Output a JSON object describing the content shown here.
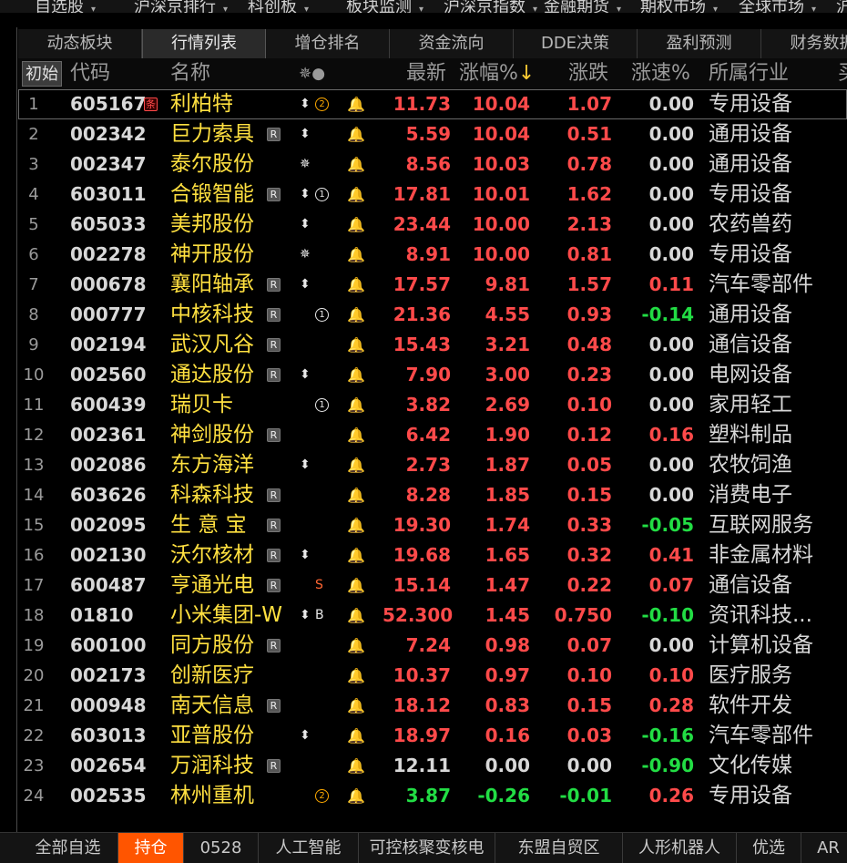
{
  "top_menu": [
    {
      "label": "自选股",
      "caret": "▾"
    },
    {
      "label": "沪深京排行",
      "caret": "▾"
    },
    {
      "label": "科创板",
      "caret": "▾"
    },
    {
      "label": "板块监测",
      "caret": "▾"
    },
    {
      "label": "沪深京指数",
      "caret": "▾"
    },
    {
      "label": "金融期货",
      "caret": "▾"
    },
    {
      "label": "期权市场",
      "caret": "▾"
    },
    {
      "label": "全球市场",
      "caret": "▾"
    },
    {
      "label": "沪",
      "caret": ""
    }
  ],
  "tabs": [
    "动态板块",
    "行情列表",
    "增仓排名",
    "资金流向",
    "DDE决策",
    "盈利预测",
    "财务数据"
  ],
  "header": {
    "index": "初始",
    "code": "代码",
    "name": "名称",
    "marks": "✵●",
    "last": "最新",
    "pct": "涨幅%",
    "pct_arrow": "↓",
    "chg": "涨跌",
    "speed": "涨速%",
    "industry": "所属行业",
    "extra": "买"
  },
  "rows": [
    {
      "idx": "1",
      "code": "605167",
      "name": "利柏特",
      "tag": "条",
      "tagType": "t",
      "m1": "⬍",
      "m2": "②",
      "m2c": "orange",
      "bell": "on",
      "last": "11.73",
      "pct": "10.04",
      "chg": "1.07",
      "speed": "0.00",
      "industry": "专用设备",
      "dir": "up",
      "spdDir": "flat"
    },
    {
      "idx": "2",
      "code": "002342",
      "name": "巨力索具",
      "tag": "R",
      "tagType": "r",
      "m1": "⬍",
      "m2": "",
      "m2c": "",
      "bell": "on",
      "last": "5.59",
      "pct": "10.04",
      "chg": "0.51",
      "speed": "0.00",
      "industry": "通用设备",
      "dir": "up",
      "spdDir": "flat"
    },
    {
      "idx": "3",
      "code": "002347",
      "name": "泰尔股份",
      "tag": "",
      "tagType": "",
      "m1": "✵",
      "m2": "",
      "m2c": "",
      "bell": "on",
      "last": "8.56",
      "pct": "10.03",
      "chg": "0.78",
      "speed": "0.00",
      "industry": "通用设备",
      "dir": "up",
      "spdDir": "flat"
    },
    {
      "idx": "4",
      "code": "603011",
      "name": "合锻智能",
      "tag": "R",
      "tagType": "r",
      "m1": "⬍",
      "m2": "①",
      "m2c": "",
      "bell": "on",
      "last": "17.81",
      "pct": "10.01",
      "chg": "1.62",
      "speed": "0.00",
      "industry": "专用设备",
      "dir": "up",
      "spdDir": "flat"
    },
    {
      "idx": "5",
      "code": "605033",
      "name": "美邦股份",
      "tag": "",
      "tagType": "",
      "m1": "⬍",
      "m2": "",
      "m2c": "",
      "bell": "off",
      "last": "23.44",
      "pct": "10.00",
      "chg": "2.13",
      "speed": "0.00",
      "industry": "农药兽药",
      "dir": "up",
      "spdDir": "flat"
    },
    {
      "idx": "6",
      "code": "002278",
      "name": "神开股份",
      "tag": "",
      "tagType": "",
      "m1": "✵",
      "m2": "",
      "m2c": "",
      "bell": "off",
      "last": "8.91",
      "pct": "10.00",
      "chg": "0.81",
      "speed": "0.00",
      "industry": "专用设备",
      "dir": "up",
      "spdDir": "flat"
    },
    {
      "idx": "7",
      "code": "000678",
      "name": "襄阳轴承",
      "tag": "R",
      "tagType": "r",
      "m1": "⬍",
      "m2": "",
      "m2c": "",
      "bell": "on",
      "last": "17.57",
      "pct": "9.81",
      "chg": "1.57",
      "speed": "0.11",
      "industry": "汽车零部件",
      "dir": "up",
      "spdDir": "up"
    },
    {
      "idx": "8",
      "code": "000777",
      "name": "中核科技",
      "tag": "R",
      "tagType": "r",
      "m1": "",
      "m2": "①",
      "m2c": "",
      "bell": "on",
      "last": "21.36",
      "pct": "4.55",
      "chg": "0.93",
      "speed": "-0.14",
      "industry": "通用设备",
      "dir": "up",
      "spdDir": "down"
    },
    {
      "idx": "9",
      "code": "002194",
      "name": "武汉凡谷",
      "tag": "R",
      "tagType": "r",
      "m1": "",
      "m2": "",
      "m2c": "",
      "bell": "on",
      "last": "15.43",
      "pct": "3.21",
      "chg": "0.48",
      "speed": "0.00",
      "industry": "通信设备",
      "dir": "up",
      "spdDir": "flat"
    },
    {
      "idx": "10",
      "code": "002560",
      "name": "通达股份",
      "tag": "R",
      "tagType": "r",
      "m1": "⬍",
      "m2": "",
      "m2c": "",
      "bell": "off",
      "last": "7.90",
      "pct": "3.00",
      "chg": "0.23",
      "speed": "0.00",
      "industry": "电网设备",
      "dir": "up",
      "spdDir": "flat"
    },
    {
      "idx": "11",
      "code": "600439",
      "name": "瑞贝卡",
      "tag": "",
      "tagType": "",
      "m1": "",
      "m2": "①",
      "m2c": "",
      "bell": "on",
      "last": "3.82",
      "pct": "2.69",
      "chg": "0.10",
      "speed": "0.00",
      "industry": "家用轻工",
      "dir": "up",
      "spdDir": "flat"
    },
    {
      "idx": "12",
      "code": "002361",
      "name": "神剑股份",
      "tag": "R",
      "tagType": "r",
      "m1": "",
      "m2": "",
      "m2c": "",
      "bell": "on",
      "last": "6.42",
      "pct": "1.90",
      "chg": "0.12",
      "speed": "0.16",
      "industry": "塑料制品",
      "dir": "up",
      "spdDir": "up"
    },
    {
      "idx": "13",
      "code": "002086",
      "name": "东方海洋",
      "tag": "",
      "tagType": "",
      "m1": "⬍",
      "m2": "",
      "m2c": "",
      "bell": "off",
      "last": "2.73",
      "pct": "1.87",
      "chg": "0.05",
      "speed": "0.00",
      "industry": "农牧饲渔",
      "dir": "up",
      "spdDir": "flat"
    },
    {
      "idx": "14",
      "code": "603626",
      "name": "科森科技",
      "tag": "R",
      "tagType": "r",
      "m1": "",
      "m2": "",
      "m2c": "",
      "bell": "on",
      "last": "8.28",
      "pct": "1.85",
      "chg": "0.15",
      "speed": "0.00",
      "industry": "消费电子",
      "dir": "up",
      "spdDir": "flat"
    },
    {
      "idx": "15",
      "code": "002095",
      "name": "生 意 宝",
      "tag": "R",
      "tagType": "r",
      "m1": "",
      "m2": "",
      "m2c": "",
      "bell": "off",
      "last": "19.30",
      "pct": "1.74",
      "chg": "0.33",
      "speed": "-0.05",
      "industry": "互联网服务",
      "dir": "up",
      "spdDir": "down"
    },
    {
      "idx": "16",
      "code": "002130",
      "name": "沃尔核材",
      "tag": "R",
      "tagType": "r",
      "m1": "⬍",
      "m2": "",
      "m2c": "",
      "bell": "on",
      "last": "19.68",
      "pct": "1.65",
      "chg": "0.32",
      "speed": "0.41",
      "industry": "非金属材料",
      "dir": "up",
      "spdDir": "up"
    },
    {
      "idx": "17",
      "code": "600487",
      "name": "亨通光电",
      "tag": "R",
      "tagType": "r",
      "m1": "",
      "m2": "S",
      "m2c": "sorange",
      "bell": "on",
      "last": "15.14",
      "pct": "1.47",
      "chg": "0.22",
      "speed": "0.07",
      "industry": "通信设备",
      "dir": "up",
      "spdDir": "up"
    },
    {
      "idx": "18",
      "code": "01810",
      "name": "小米集团-W",
      "tag": "",
      "tagType": "",
      "m1": "⬍",
      "m2": "B",
      "m2c": "",
      "bell": "on",
      "last": "52.300",
      "pct": "1.45",
      "chg": "0.750",
      "speed": "-0.10",
      "industry": "资讯科技...",
      "dir": "up",
      "spdDir": "down"
    },
    {
      "idx": "19",
      "code": "600100",
      "name": "同方股份",
      "tag": "R",
      "tagType": "r",
      "m1": "",
      "m2": "",
      "m2c": "",
      "bell": "off",
      "last": "7.24",
      "pct": "0.98",
      "chg": "0.07",
      "speed": "0.00",
      "industry": "计算机设备",
      "dir": "up",
      "spdDir": "flat"
    },
    {
      "idx": "20",
      "code": "002173",
      "name": "创新医疗",
      "tag": "",
      "tagType": "",
      "m1": "",
      "m2": "",
      "m2c": "",
      "bell": "on",
      "last": "10.37",
      "pct": "0.97",
      "chg": "0.10",
      "speed": "0.10",
      "industry": "医疗服务",
      "dir": "up",
      "spdDir": "up"
    },
    {
      "idx": "21",
      "code": "000948",
      "name": "南天信息",
      "tag": "R",
      "tagType": "r",
      "m1": "",
      "m2": "",
      "m2c": "",
      "bell": "on",
      "last": "18.12",
      "pct": "0.83",
      "chg": "0.15",
      "speed": "0.28",
      "industry": "软件开发",
      "dir": "up",
      "spdDir": "up"
    },
    {
      "idx": "22",
      "code": "603013",
      "name": "亚普股份",
      "tag": "",
      "tagType": "",
      "m1": "⬍",
      "m2": "",
      "m2c": "",
      "bell": "off",
      "last": "18.97",
      "pct": "0.16",
      "chg": "0.03",
      "speed": "-0.16",
      "industry": "汽车零部件",
      "dir": "up",
      "spdDir": "down"
    },
    {
      "idx": "23",
      "code": "002654",
      "name": "万润科技",
      "tag": "R",
      "tagType": "r",
      "m1": "",
      "m2": "",
      "m2c": "",
      "bell": "on",
      "last": "12.11",
      "pct": "0.00",
      "chg": "0.00",
      "speed": "-0.90",
      "industry": "文化传媒",
      "dir": "flat",
      "spdDir": "down"
    },
    {
      "idx": "24",
      "code": "002535",
      "name": "林州重机",
      "tag": "",
      "tagType": "",
      "m1": "",
      "m2": "②",
      "m2c": "orange",
      "bell": "on",
      "last": "3.87",
      "pct": "-0.26",
      "chg": "-0.01",
      "speed": "0.26",
      "industry": "专用设备",
      "dir": "down",
      "spdDir": "up"
    }
  ],
  "bottom_tabs": [
    "全部自选",
    "持仓",
    "0528",
    "人工智能",
    "可控核聚变核电",
    "东盟自贸区",
    "人形机器人",
    "优选",
    "AR"
  ],
  "active_bottom_tab": 1,
  "active_tab": 1,
  "colors": {
    "up": "#ff4a4a",
    "down": "#22dd44",
    "name": "#ffe040",
    "active_bottom": "#ff5500"
  },
  "icons": {
    "bell": "bell-icon",
    "level": "circled-number-icon",
    "updown": "updown-arrow-icon",
    "star": "star-burst-icon"
  }
}
